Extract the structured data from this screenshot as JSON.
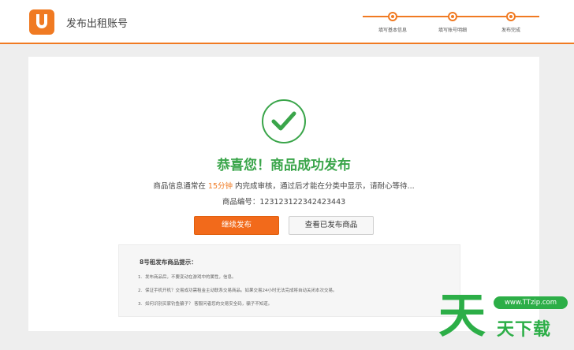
{
  "header": {
    "title": "发布出租账号",
    "brand_color": "#f07a22",
    "steps": [
      {
        "label": "填写基本信息"
      },
      {
        "label": "填写账号明细"
      },
      {
        "label": "发布完成"
      }
    ]
  },
  "result": {
    "title": "恭喜您！商品成功发布",
    "notice_prefix": "商品信息通常在",
    "notice_highlight": "15分钟",
    "notice_suffix": "内完成审核，通过后才能在分类中显示，请耐心等待...",
    "product_no_label": "商品编号：",
    "product_no": "123123122342423443",
    "success_color": "#3aa54a"
  },
  "actions": {
    "continue_label": "继续发布",
    "view_label": "查看已发布商品"
  },
  "tips": {
    "title": "8号租发布商品提示：",
    "items": [
      {
        "num": "1.",
        "text": "发布商品后，不要变动在游戏中的属性，信息。"
      },
      {
        "num": "2.",
        "text": "保证手机开机？交易成功需租金主动联系交易商品。如果交易24小时无法完成将自动关闭本次交易。"
      },
      {
        "num": "3.",
        "text": "如何识别买家钓鱼骗子？ 客服问者您的交易安全码，骗子不知道。"
      }
    ]
  },
  "watermark": {
    "glyph": "天",
    "url": "www.TTzip.com",
    "name": "天下载",
    "color": "#2cae47"
  }
}
